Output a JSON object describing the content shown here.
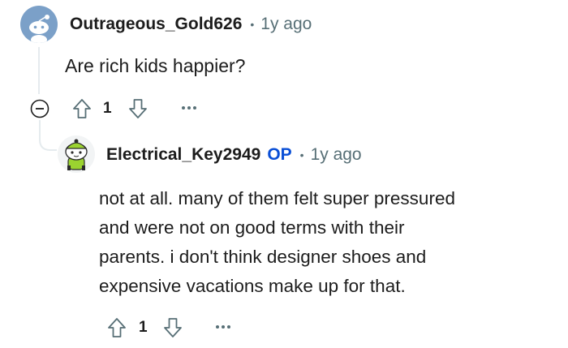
{
  "comment": {
    "username": "Outrageous_Gold626",
    "separator": "•",
    "age": "1y ago",
    "body": "Are rich kids happier?",
    "votes": "1",
    "icons": {
      "avatar": "snoo-avatar-icon",
      "collapse": "collapse-minus-icon",
      "upvote": "upvote-arrow-icon",
      "downvote": "downvote-arrow-icon",
      "more": "more-options-icon"
    }
  },
  "reply": {
    "username": "Electrical_Key2949",
    "op_badge": "OP",
    "separator": "•",
    "age": "1y ago",
    "body_lines": [
      "not at all. many of them felt super pressured",
      "and were not on good terms with their",
      "parents. i don't think designer shoes and",
      "expensive vacations make up for that."
    ],
    "votes": "1",
    "icons": {
      "avatar": "green-snoo-avatar-icon",
      "upvote": "upvote-arrow-icon",
      "downvote": "downvote-arrow-icon",
      "more": "more-options-icon"
    }
  },
  "colors": {
    "op": "#0a4fd6",
    "meta": "#576f76",
    "avatar_bg": "#7ba0c8",
    "thread_line": "#e5ebee"
  }
}
